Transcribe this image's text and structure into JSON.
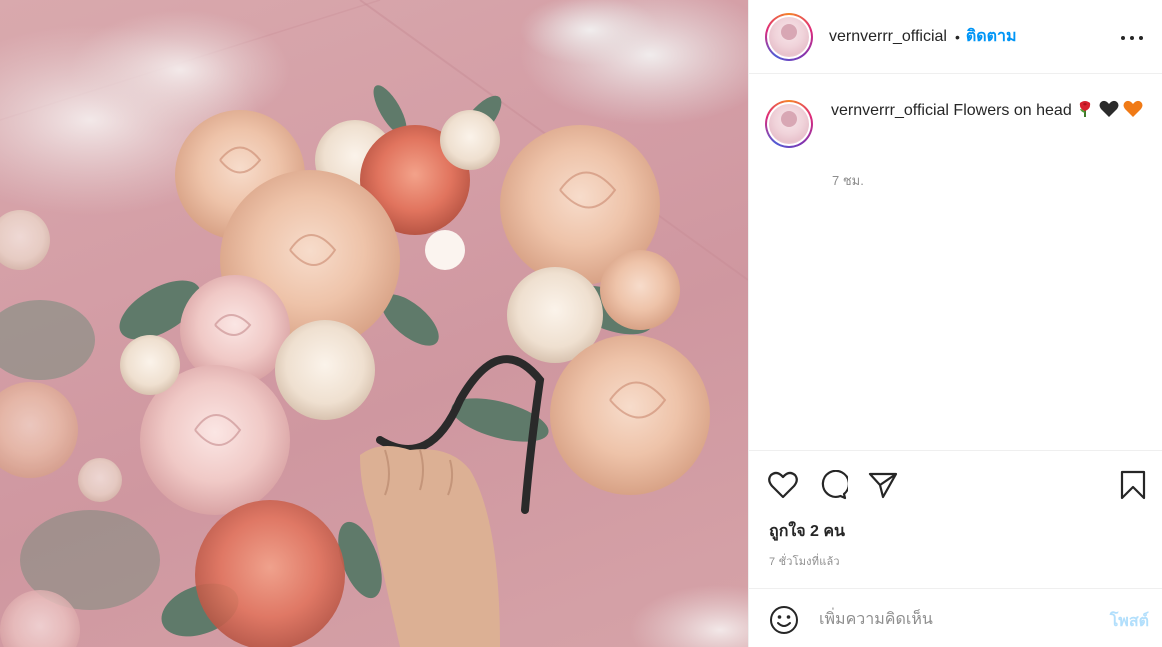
{
  "post": {
    "username": "vernverrr_official",
    "separator": "•",
    "follow_label": "ติดตาม",
    "caption_text": "Flowers on head",
    "caption_emojis": [
      "rose-emoji",
      "black-heart-emoji",
      "orange-heart-emoji"
    ],
    "caption_time": "7 ชม.",
    "likes_text": "ถูกใจ 2 คน",
    "posted_ago": "7 ชั่วโมงที่แล้ว"
  },
  "comment": {
    "placeholder": "เพิ่มความคิดเห็น",
    "post_label": "โพสต์"
  },
  "icons": {
    "more": "more-horizontal-icon",
    "like": "heart-icon",
    "comment": "comment-bubble-icon",
    "share": "paper-plane-icon",
    "save": "bookmark-icon",
    "emoji": "smiley-face-icon"
  },
  "colors": {
    "accent": "#0095f6",
    "post_disabled": "#b2dffc",
    "text": "#262626",
    "muted": "#8e8e8e",
    "photo_background": "#d49ea6"
  }
}
